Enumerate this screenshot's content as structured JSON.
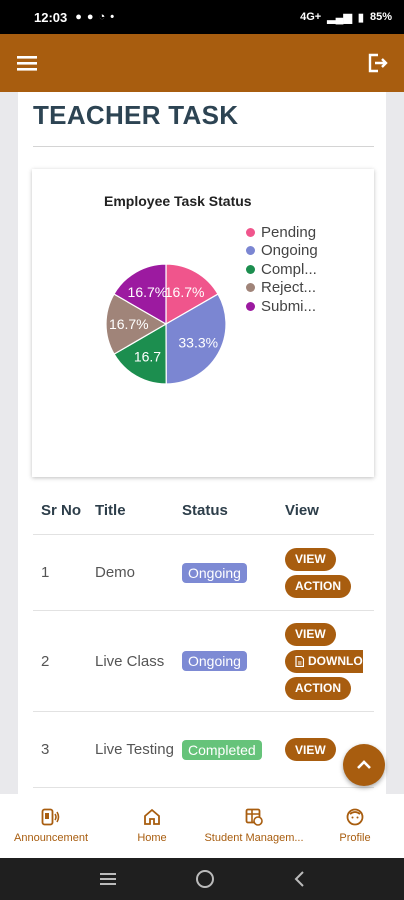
{
  "status_bar": {
    "time": "12:03",
    "battery": "85%",
    "network": "4G+"
  },
  "page": {
    "title": "TEACHER TASK"
  },
  "chart_data": {
    "type": "pie",
    "title": "Employee Task Status",
    "labels": [
      "Pending",
      "Ongoing",
      "Compl...",
      "Reject...",
      "Submi..."
    ],
    "values": [
      16.7,
      33.3,
      16.7,
      16.7,
      16.7
    ],
    "slice_labels": [
      "16.7%",
      "33.3%",
      "16.7",
      "16.7%",
      "16.7%"
    ],
    "colors": [
      "#f0558c",
      "#7b86d2",
      "#1c8e4f",
      "#a08479",
      "#9c1aa0"
    ],
    "legend_position": "right"
  },
  "table": {
    "headers": {
      "sr": "Sr No",
      "title": "Title",
      "status": "Status",
      "view": "View"
    },
    "rows": [
      {
        "sr": "1",
        "title": "Demo",
        "status": "Ongoing",
        "actions": [
          "VIEW",
          "ACTION"
        ]
      },
      {
        "sr": "2",
        "title": "Live Class",
        "status": "Ongoing",
        "actions": [
          "VIEW",
          "DOWNLO",
          "ACTION"
        ]
      },
      {
        "sr": "3",
        "title": "Live Testing",
        "status": "Completed",
        "actions": [
          "VIEW"
        ]
      }
    ]
  },
  "bottom_nav": {
    "announcement": "Announcement",
    "home": "Home",
    "student_management": "Student Managem...",
    "profile": "Profile"
  },
  "colors": {
    "accent": "#a85d0f",
    "ongoing": "#7d8ad4",
    "completed": "#66c37a",
    "title_text": "#2d4453"
  }
}
